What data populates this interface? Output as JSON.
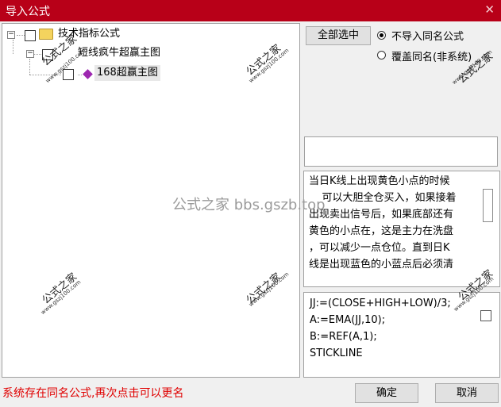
{
  "window": {
    "title": "导入公式",
    "close_glyph": "✕"
  },
  "tree": {
    "root_label": "技术指标公式",
    "child_label": "短线疯牛超赢主图",
    "leaf_label": "168超赢主图",
    "collapse_glyph": "−"
  },
  "options": {
    "select_all_label": "全部选中",
    "radio_no_import_label": "不导入同名公式",
    "radio_overwrite_label": "覆盖同名(非系统)"
  },
  "description": {
    "lines": [
      "当日K线上出现黄色小点的时候",
      "    可以大胆全仓买入，如果接着",
      "出现卖出信号后，如果底部还有",
      "黄色的小点在，这是主力在洗盘",
      "，可以减少一点仓位。直到日K",
      "线是出现蓝色的小蓝点后必须清"
    ]
  },
  "code": {
    "lines": [
      "JJ:=(CLOSE+HIGH+LOW)/3;",
      "A:=EMA(JJ,10);",
      "B:=REF(A,1);",
      "STICKLINE"
    ]
  },
  "watermark": {
    "main": "公式之家",
    "sub": "www.gszj100.com",
    "center": "公式之家 bbs.gszb.top"
  },
  "status_message": "系统存在同名公式,再次点击可以更名",
  "buttons": {
    "ok_label": "确定",
    "cancel_label": "取消"
  },
  "colors": {
    "titlebar": "#b80018",
    "status": "#e00000"
  }
}
